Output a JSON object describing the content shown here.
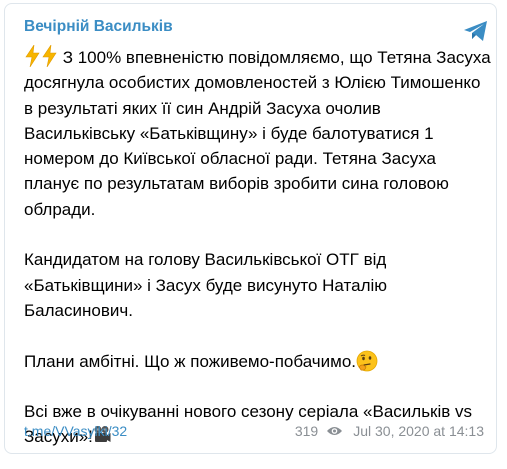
{
  "channel": {
    "title": "Вечірній Васильків"
  },
  "message": {
    "paragraph1_text": "З 100% впевненістю повідомляємо, що Тетяна Засуха досягнула особистих домовленостей з Юлією Тимошенко в результаті яких її син Андрій Засуха очолив Васильківську «Батьківщину» і буде балотуватися 1 номером до Київської обласної ради. Тетяна Засуха планує по результатам виборів зробити сина головою облради.",
    "paragraph2_text": "Кандидатом на голову Васильківської ОТГ від «Батьківщини» і Засух буде висунуто Наталію Баласинович.",
    "paragraph3_text": "Плани амбітні. Що ж поживемо-побачимо.",
    "paragraph4_text": "Всі вже в очікуванні нового сезону серіала «Васильків vs Засухи»!",
    "icons": [
      "lightning-icon",
      "lightning-icon",
      "thinking-face-icon",
      "movie-camera-icon"
    ]
  },
  "footer": {
    "link": "t.me/VVasylki/32",
    "views": "319",
    "date": "Jul 30, 2020 at 14:13"
  },
  "colors": {
    "accent": "#3b8dc4",
    "meta": "#8a8f94",
    "border": "#dfe6ec"
  }
}
